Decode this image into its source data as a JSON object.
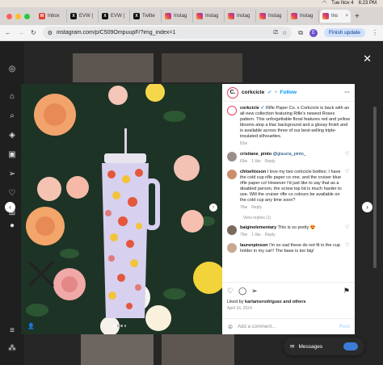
{
  "menubar": {
    "date": "Tue Nov 4",
    "time": "6:23 PM"
  },
  "colors": {
    "traffic_red": "#ff5f57",
    "traffic_yellow": "#febc2e",
    "traffic_green": "#28c840",
    "ig_blue": "#0095f6"
  },
  "tabs": [
    {
      "label": "Inbox",
      "icon": "gmail-icon"
    },
    {
      "label": "EVW (",
      "icon": "x-icon"
    },
    {
      "label": "EVW (",
      "icon": "x-icon"
    },
    {
      "label": "Twitte",
      "icon": "x-icon"
    },
    {
      "label": "Instag",
      "icon": "instagram-icon"
    },
    {
      "label": "Instag",
      "icon": "instagram-icon"
    },
    {
      "label": "Instag",
      "icon": "instagram-icon"
    },
    {
      "label": "Instag",
      "icon": "instagram-icon"
    },
    {
      "label": "Instag",
      "icon": "instagram-icon"
    },
    {
      "label": "Ins",
      "icon": "instagram-icon",
      "active": true
    }
  ],
  "address": {
    "url": "instagram.com/p/C509OmpuupF/?img_index=1",
    "finish_update": "Finish update",
    "profile_initial": "E"
  },
  "post": {
    "username": "corkcicle",
    "follow": "Follow",
    "caption_user": "corkcicle",
    "caption": "Rifle Paper Co. x Corkcicle is back with an all-new collection featuring Rifle's newest Roses pattern. This unforgettable floral features red and yellow blooms atop a lilac background and a glossy finish and is available across three of our best-selling triple-insulated silhouettes.",
    "caption_time": "81w",
    "comments": [
      {
        "user": "cristiane_pinto",
        "text": "",
        "mention": "@glaucia_pinto_",
        "time": "69w",
        "likes": "1 like",
        "reply": "Reply",
        "avatar_color": "#9a8f88"
      },
      {
        "user": "chloehixson",
        "text": "I love my two corkcicle bottles; I have the cold cup rifle paper co one, and the cruiser blue rifle paper co! However I'd just like to say that as a disabled person, the screw top lid is much harder to use. Will the cruiser rifle co colours be available on the cold cup any time soon?",
        "mention": "",
        "time": "76w",
        "likes": "",
        "reply": "Reply",
        "avatar_color": "#c98f6a"
      },
      {
        "user": "baiginelementary",
        "text": "This is so pretty 😍",
        "mention": "",
        "time": "79w",
        "likes": "1 like",
        "reply": "Reply",
        "avatar_color": "#7b6b5c"
      },
      {
        "user": "laurenpinson",
        "text": "I'm so sad these do not fit in the cup holder in my car!! The base is too big!",
        "mention": "",
        "time": "",
        "likes": "",
        "reply": "",
        "avatar_color": "#c9a892"
      }
    ],
    "view_replies": "View replies (1)",
    "liked_by_prefix": "Liked by",
    "liked_by_user": "karlamsrodriguez",
    "liked_by_suffix": "and others",
    "date": "April 16, 2024",
    "add_comment_placeholder": "Add a comment...",
    "post_label": "Post"
  },
  "messages": {
    "label": "Messages"
  }
}
